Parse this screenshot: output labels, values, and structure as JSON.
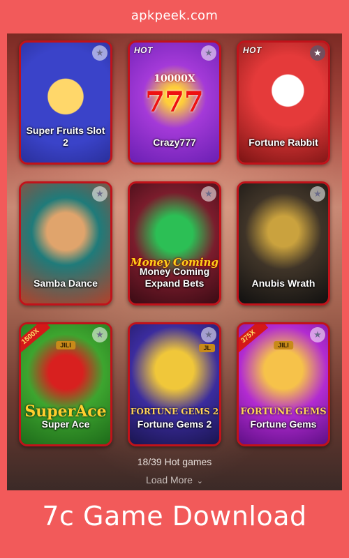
{
  "site": {
    "name": "apkpeek.com"
  },
  "games": [
    {
      "title": "Super Fruits Slot 2",
      "hot": ""
    },
    {
      "title": "Crazy777",
      "hot": "HOT",
      "art_text": "10000X"
    },
    {
      "title": "Fortune Rabbit",
      "hot": "HOT"
    },
    {
      "title": "Samba Dance",
      "hot": ""
    },
    {
      "title": "Money Coming Expand Bets",
      "hot": "",
      "art_text": "Money Coming"
    },
    {
      "title": "Anubis Wrath",
      "hot": ""
    },
    {
      "title": "Super Ace",
      "hot": "",
      "badge": "1500X",
      "jili": "JILI",
      "art_text": "SuperAce"
    },
    {
      "title": "Fortune Gems 2",
      "hot": "",
      "jili": "JL",
      "art_text": "FORTUNE GEMS 2"
    },
    {
      "title": "Fortune Gems",
      "hot": "",
      "badge": "375X",
      "jili": "JILI",
      "art_text": "FORTUNE GEMS"
    }
  ],
  "footer": {
    "count": "18/39 Hot games",
    "load_more": "Load More",
    "chevron": "⌄"
  },
  "headline": "7c Game Download",
  "icons": {
    "favorite": "star-icon",
    "load_more": "chevron-down-icon"
  },
  "colors": {
    "background": "#f25a5a",
    "card_border": "#c1121a"
  }
}
